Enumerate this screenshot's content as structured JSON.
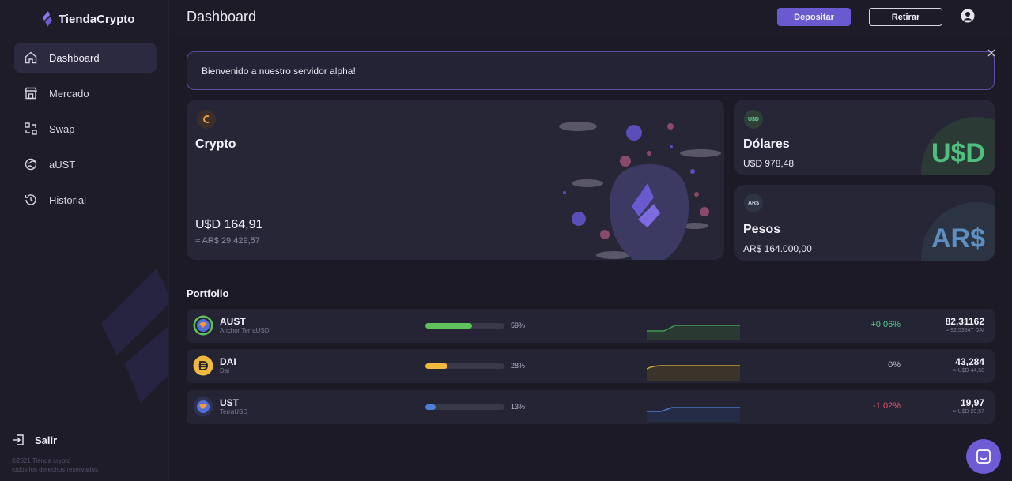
{
  "app": {
    "name": "TiendaCrypto",
    "brand_color": "#6a5ad0"
  },
  "sidebar": {
    "items": [
      {
        "label": "Dashboard",
        "icon": "home-icon",
        "active": true
      },
      {
        "label": "Mercado",
        "icon": "store-icon",
        "active": false
      },
      {
        "label": "Swap",
        "icon": "swap-icon",
        "active": false
      },
      {
        "label": "aUST",
        "icon": "globe-icon",
        "active": false
      },
      {
        "label": "Historial",
        "icon": "history-icon",
        "active": false
      }
    ],
    "logout_label": "Salir",
    "copyright_line1": "©2021 Tienda crypto",
    "copyright_line2": "todos los derechos reservados"
  },
  "header": {
    "title": "Dashboard",
    "deposit_label": "Depositar",
    "withdraw_label": "Retirar"
  },
  "banner": {
    "message": "Bienvenido a nuestro servidor alpha!"
  },
  "cards": {
    "crypto": {
      "title": "Crypto",
      "value": "U$D 164,91",
      "sub": "≈ AR$ 29.429,57"
    },
    "dolares": {
      "badge": "U$D",
      "title": "Dólares",
      "value": "U$D 978,48",
      "big_symbol": "U$D",
      "color": "#4fbf7f"
    },
    "pesos": {
      "badge": "AR$",
      "title": "Pesos",
      "value": "AR$ 164.000,00",
      "big_symbol": "AR$",
      "color": "#5e8fc0"
    }
  },
  "portfolio": {
    "title": "Portfolio",
    "rows": [
      {
        "symbol": "AUST",
        "name": "Anchor TerraUSD",
        "percent": "59%",
        "fill": 0.59,
        "bar_color": "#5fc25a",
        "change": "+0.06%",
        "change_color": "#4fcf8a",
        "amount": "82,31162",
        "conversion": "≈ 92,53847 DAI",
        "spark_color": "#3f9a4e"
      },
      {
        "symbol": "DAI",
        "name": "Dai",
        "percent": "28%",
        "fill": 0.28,
        "bar_color": "#f2b940",
        "change": "0%",
        "change_color": "#b9b6c8",
        "amount": "43,284",
        "conversion": "≈ U$D 44,58",
        "spark_color": "#d1a13a"
      },
      {
        "symbol": "UST",
        "name": "TerraUSD",
        "percent": "13%",
        "fill": 0.13,
        "bar_color": "#4c7fd8",
        "change": "-1.02%",
        "change_color": "#e0556a",
        "amount": "19,97",
        "conversion": "≈ U$D 20,57",
        "spark_color": "#4a76c8"
      }
    ]
  }
}
